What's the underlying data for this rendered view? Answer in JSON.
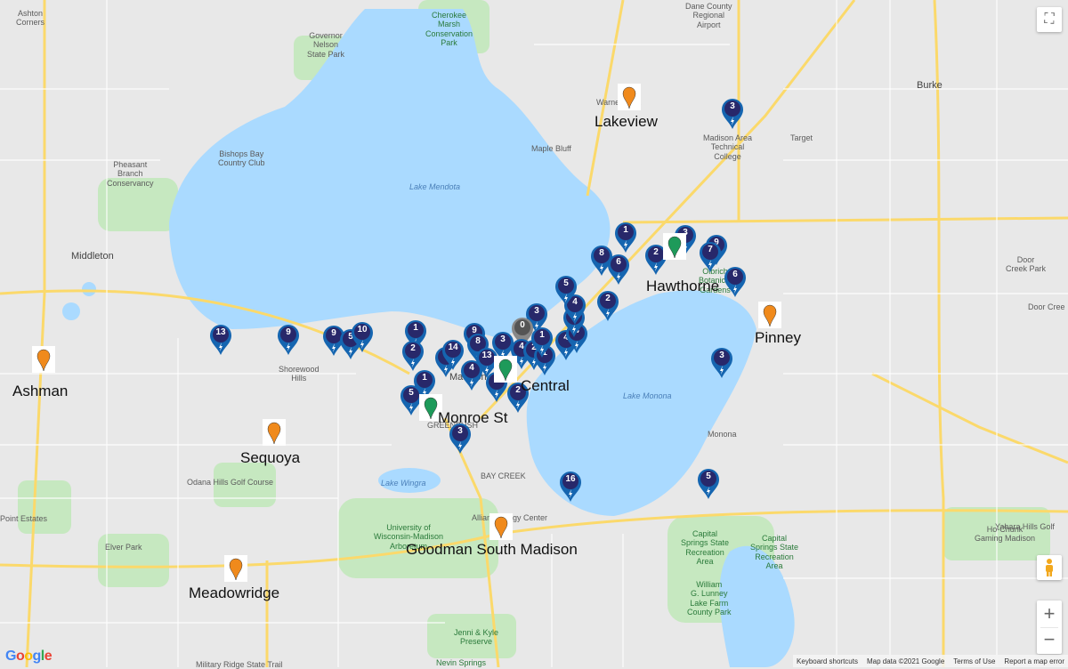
{
  "colors": {
    "water": "#aadaff",
    "land": "#e8e8e8",
    "park": "#c6e8c0",
    "road": "#fbd96b",
    "marker": "#1565b0",
    "marker_head": "#28286a",
    "school_pin": "#f08a1c",
    "school_pin_current": "#1e9a5a",
    "cluster_gray": "#888888"
  },
  "schools": [
    {
      "name": "Lakeview",
      "pin": "orange"
    },
    {
      "name": "Pinney",
      "pin": "orange"
    },
    {
      "name": "Ashman",
      "pin": "orange"
    },
    {
      "name": "Sequoya",
      "pin": "orange"
    },
    {
      "name": "Goodman South Madison",
      "pin": "orange"
    },
    {
      "name": "Meadowridge",
      "pin": "orange"
    },
    {
      "name": "Central",
      "pin": "green"
    },
    {
      "name": "Monroe St",
      "pin": "green"
    },
    {
      "name": "Hawthorne",
      "pin": "green"
    }
  ],
  "markers": [
    13,
    9,
    9,
    5,
    10,
    1,
    2,
    1,
    5,
    9,
    14,
    4,
    9,
    8,
    13,
    3,
    2,
    2,
    3,
    0,
    4,
    2,
    1,
    1,
    4,
    4,
    11,
    4,
    5,
    2,
    8,
    6,
    1,
    2,
    3,
    9,
    7,
    6,
    3,
    3,
    5,
    16,
    3
  ],
  "map_labels": {
    "lake_mendota": "Lake Mendota",
    "lake_monona": "Lake Monona",
    "lake_wingra": "Lake Wingra",
    "middleton": "Middleton",
    "maple_bluff": "Maple Bluff",
    "monona": "Monona",
    "burke": "Burke",
    "ashton_corners": "Ashton\nCorners",
    "governor_nelson": "Governor\nNelson\nState Park",
    "cherokee": "Cherokee\nMarsh\nConservation\nPark",
    "dane_airport": "Dane County\nRegional\nAirport",
    "pheasant": "Pheasant\nBranch\nConservancy",
    "bishops_bay": "Bishops Bay\nCountry Club",
    "warner_park": "Warner Park",
    "matc": "Madison Area\nTechnical\nCollege",
    "target": "Target",
    "shorewood": "Shorewood\nHills",
    "madison": "Madison",
    "greenbush": "GREENBUSH",
    "bay_creek": "BAY CREEK",
    "odana": "Odana Hills Golf Course",
    "uw_arboretum": "University of\nWisconsin-Madison\nArboretum",
    "alliant": "Alliant Energy Center",
    "elver": "Elver Park",
    "capital_springs": "Capital\nSprings State\nRecreation\nArea",
    "lunney": "William\nG. Lunney\nLake Farm\nCounty Park",
    "hochunk": "Ho-Chunk\nGaming Madison",
    "yahara": "Yahara Hills Golf",
    "door_creek": "Door\nCreek Park",
    "door_cree2": "Door Cree",
    "jenni": "Jenni & Kyle\nPreserve",
    "nevin": "Nevin Springs",
    "point_estates": "Point Estates",
    "olbrich": "Olbrich\nBotanical\nGardens",
    "military": "Military Ridge State Trail"
  },
  "controls": {
    "fullscreen": "⛶",
    "zoom_in": "+",
    "zoom_out": "−",
    "pegman": "pegman"
  },
  "footer": {
    "keyboard": "Keyboard shortcuts",
    "mapdata": "Map data ©2021 Google",
    "terms": "Terms of Use",
    "report": "Report a map error"
  },
  "logo": "Google"
}
